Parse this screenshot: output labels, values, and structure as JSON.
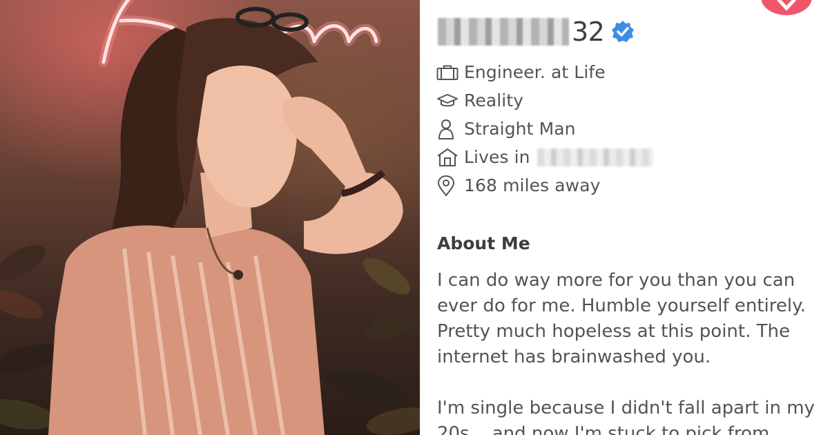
{
  "photo": {
    "neon_sign_text": "Nom",
    "subject": "profile-photo"
  },
  "profile": {
    "age": "32",
    "verified_color": "#3a8ee6",
    "info": [
      {
        "icon": "briefcase-icon",
        "text": "Engineer. at Life"
      },
      {
        "icon": "graduation-cap-icon",
        "text": "Reality"
      },
      {
        "icon": "person-icon",
        "text": "Straight Man"
      },
      {
        "icon": "home-icon",
        "text": "Lives in"
      },
      {
        "icon": "location-pin-icon",
        "text": "168 miles away"
      }
    ],
    "about_title": "About Me",
    "about_text": "I can do way more for you than you can ever do for me. Humble yourself entirely. Pretty much hopeless at this point. The internet has brainwashed you.\n\nI'm single because I didn't fall apart in my 20s... and now I'm stuck to pick from"
  },
  "colors": {
    "accent": "#f0566b",
    "text": "#505458",
    "heading": "#3a3d42"
  }
}
